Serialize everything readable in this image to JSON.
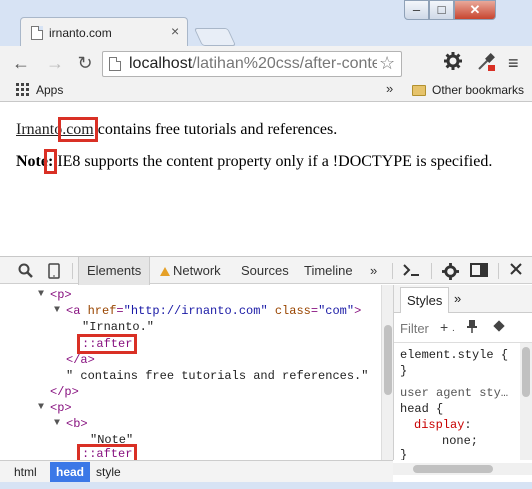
{
  "window": {
    "tab_title": "irnanto.com",
    "tab_close": "×",
    "minimize": "–",
    "maximize": "□",
    "close": "✕"
  },
  "toolbar": {
    "back": "←",
    "forward": "→",
    "reload": "↻",
    "url_host": "localhost",
    "url_path": "/latihan%20css/after-conte",
    "star": "☆",
    "menu": "≡"
  },
  "bookmarks": {
    "apps_label": "Apps",
    "more": "»",
    "other_label": "Other bookmarks"
  },
  "page": {
    "link_text": "Irnanto",
    "after_text": ".com",
    "line1_rest": " contains free tutorials and references.",
    "note_label": "Note",
    "note_after": ":",
    "line2_rest": " IE8 supports the content property only if a !DOCTYPE is specified."
  },
  "devtools": {
    "tabs": {
      "elements": "Elements",
      "network": "Network",
      "sources": "Sources",
      "timeline": "Timeline",
      "more": "»"
    },
    "dom": {
      "p_open": "<p>",
      "a_tag": "<a ",
      "href_attr": "href",
      "href_val": "\"http://irnanto.com\"",
      "class_attr": "class",
      "class_val": "\"com\"",
      "a_close_bracket": ">",
      "text_irnanto": "\"Irnanto.\"",
      "pseudo_after_1": "::after",
      "a_end": "</a>",
      "text_contains": "\" contains free tutorials and references.\"",
      "p_end": "</p>",
      "p_open_2": "<p>",
      "b_open": "<b>",
      "text_note": "\"Note\"",
      "pseudo_after_2": "::after"
    },
    "breadcrumbs": [
      "html",
      "head",
      "style"
    ],
    "styles": {
      "tab_label": "Styles",
      "more": "»",
      "filter_placeholder": "Filter",
      "rule1_selector": "element.style {",
      "rule1_close": "}",
      "rule2_source": "user agent sty…",
      "rule2_selector": "head {",
      "rule2_prop": "display",
      "rule2_value": "none;",
      "rule2_close": "}"
    }
  }
}
